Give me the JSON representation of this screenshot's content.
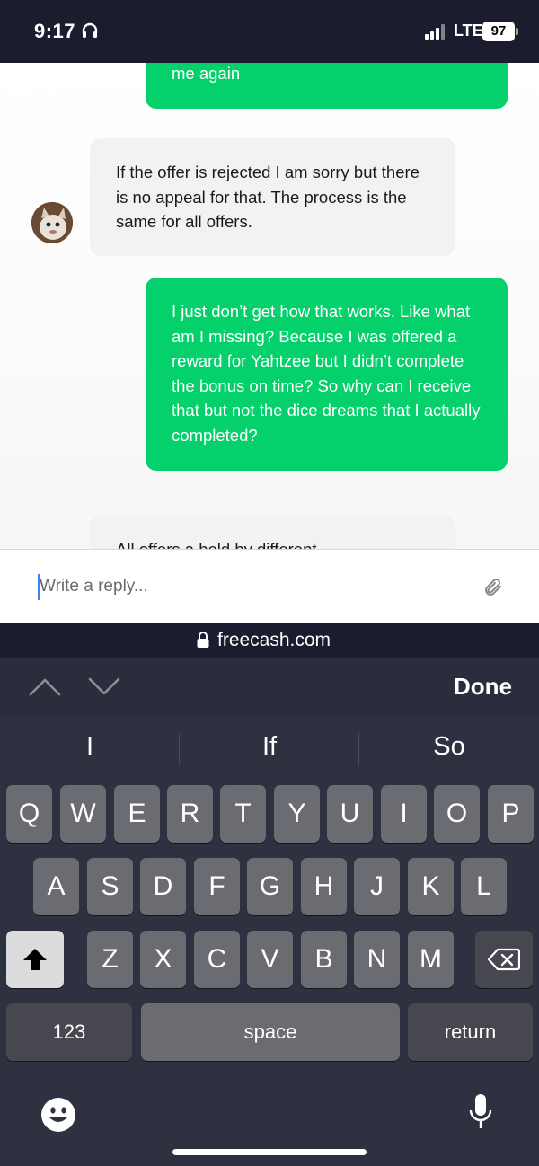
{
  "status": {
    "time": "9:17",
    "network": "LTE",
    "battery": "97"
  },
  "chat": {
    "messages": [
      {
        "from": "me",
        "text": "offer ticket again and you guys rejected me again"
      },
      {
        "from": "agent",
        "text": "If the offer is rejected I am sorry but there is no appeal for that. The process is the same for all offers."
      },
      {
        "from": "me",
        "text": "I just don’t get how that works. Like what am I missing? Because I was offered a reward for Yahtzee but I didn’t complete the bonus on time? So why can I receive that but not the dice dreams that I actually completed?"
      },
      {
        "from": "agent",
        "text": "All offers a held by different"
      }
    ]
  },
  "reply": {
    "placeholder": "Write a reply..."
  },
  "browser": {
    "url": "freecash.com"
  },
  "toolbar": {
    "done": "Done"
  },
  "keyboard": {
    "predictions": [
      "I",
      "If",
      "So"
    ],
    "row1": [
      "Q",
      "W",
      "E",
      "R",
      "T",
      "Y",
      "U",
      "I",
      "O",
      "P"
    ],
    "row2": [
      "A",
      "S",
      "D",
      "F",
      "G",
      "H",
      "J",
      "K",
      "L"
    ],
    "row3": [
      "Z",
      "X",
      "C",
      "V",
      "B",
      "N",
      "M"
    ],
    "numbers_label": "123",
    "space_label": "space",
    "return_label": "return"
  },
  "colors": {
    "my_bubble": "#05d16c",
    "agent_bubble": "#f2f2f2",
    "keyboard_bg": "#2e3140"
  }
}
